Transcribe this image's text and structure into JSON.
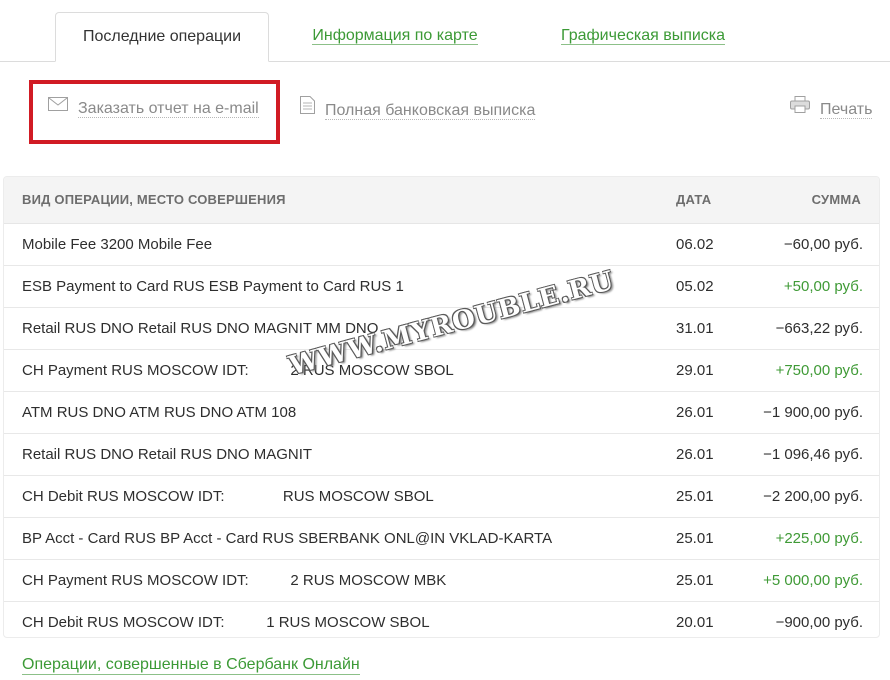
{
  "tabs": {
    "active": "Последние операции",
    "card_info": "Информация по карте",
    "graphic_statement": "Графическая выписка"
  },
  "actions": {
    "email_report": "Заказать отчет на e-mail",
    "full_statement": "Полная банковская выписка",
    "print": "Печать"
  },
  "table": {
    "headers": {
      "description": "ВИД ОПЕРАЦИИ, МЕСТО СОВЕРШЕНИЯ",
      "date": "ДАТА",
      "amount": "СУММА"
    },
    "rows": [
      {
        "description": "Mobile Fee 3200 Mobile Fee",
        "date": "06.02",
        "amount": "−60,00 руб."
      },
      {
        "description": "ESB Payment to Card RUS ESB Payment to Card RUS 1",
        "date": "05.02",
        "amount": "+50,00 руб."
      },
      {
        "description": "Retail RUS DNO Retail RUS DNO MAGNIT MM DNO",
        "date": "31.01",
        "amount": "−663,22 руб."
      },
      {
        "description": "CH Payment RUS MOSCOW IDT:          2 RUS MOSCOW SBOL",
        "date": "29.01",
        "amount": "+750,00 руб."
      },
      {
        "description": "ATM RUS DNO ATM RUS DNO ATM 108",
        "date": "26.01",
        "amount": "−1 900,00 руб."
      },
      {
        "description": "Retail RUS DNO Retail RUS DNO MAGNIT",
        "date": "26.01",
        "amount": "−1 096,46 руб."
      },
      {
        "description": "CH Debit RUS MOSCOW IDT:              RUS MOSCOW SBOL",
        "date": "25.01",
        "amount": "−2 200,00 руб."
      },
      {
        "description": "BP Acct - Card RUS BP Acct - Card RUS SBERBANK ONL@IN VKLAD-KARTA",
        "date": "25.01",
        "amount": "+225,00 руб."
      },
      {
        "description": "CH Payment RUS MOSCOW IDT:          2 RUS MOSCOW MBK",
        "date": "25.01",
        "amount": "+5 000,00 руб."
      },
      {
        "description": "CH Debit RUS MOSCOW IDT:          1 RUS MOSCOW SBOL",
        "date": "20.01",
        "amount": "−900,00 руб."
      }
    ]
  },
  "watermark": "WWW.MYROUBLE.RU",
  "bottom_link": "Операции, совершенные в Сбербанк Онлайн",
  "colors": {
    "accent_green": "#3c9a36",
    "highlight_red": "#d11b24"
  }
}
